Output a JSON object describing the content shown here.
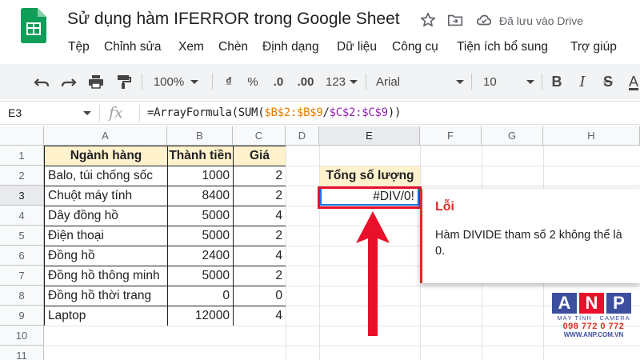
{
  "window": {
    "title": "Sử dụng hàm IFERROR trong Google Sheet",
    "saved_status": "Đã lưu vào Drive"
  },
  "menu": [
    "Tệp",
    "Chỉnh sửa",
    "Xem",
    "Chèn",
    "Định dạng",
    "Dữ liệu",
    "Công cụ",
    "Tiện ích bổ sung",
    "Trợ giúp"
  ],
  "toolbar": {
    "zoom": "100%",
    "currency": "₫",
    "percent": "%",
    "decrease_decimals": ".0",
    "increase_decimals": ".00",
    "more_formats": "123",
    "font": "Arial",
    "font_size": "10",
    "bold": "B",
    "italic": "I",
    "strikethrough": "S",
    "text_color": "A"
  },
  "formula_bar": {
    "cell_ref": "E3",
    "fx": "fx",
    "formula_prefix": "=ArrayFormula(SUM(",
    "range1": "$B$2:$B$9",
    "slash": "/",
    "range2": "$C$2:$C$9",
    "formula_suffix": "))"
  },
  "sheet": {
    "columns": [
      "A",
      "B",
      "C",
      "D",
      "E",
      "F",
      "G",
      "H"
    ],
    "rows": [
      "1",
      "2",
      "3",
      "4",
      "5",
      "6",
      "7",
      "8",
      "9",
      "10",
      "11"
    ],
    "headers": [
      "Ngành hàng",
      "Thành tiền",
      "Giá"
    ],
    "data": [
      [
        "Balo, túi chống sốc",
        "1000",
        "2"
      ],
      [
        "Chuột máy tính",
        "8400",
        "2"
      ],
      [
        "Dây đồng hồ",
        "5000",
        "4"
      ],
      [
        "Điện thoại",
        "5000",
        "2"
      ],
      [
        "Đồng hồ",
        "2400",
        "4"
      ],
      [
        "Đồng hồ thông minh",
        "5000",
        "2"
      ],
      [
        "Đồng hồ thời trang",
        "0",
        "0"
      ],
      [
        "Laptop",
        "12000",
        "4"
      ]
    ],
    "e2": "Tổng số lượng",
    "e3": "#DIV/0!"
  },
  "error_tooltip": {
    "title": "Lỗi",
    "message": "Hàm DIVIDE tham số 2 không thể là 0."
  },
  "watermark": {
    "letters": [
      "A",
      "N",
      "P"
    ],
    "subtitle": "MÁY TÍNH · CAMERA",
    "phone": "098 772 0 772",
    "website": "WWW.ANP.COM.VN"
  },
  "colors": {
    "sheets_green": "#0f9d58",
    "error_red": "#d93025",
    "highlight_red": "#e8102a",
    "header_yellow": "#fff2cc",
    "anp_blue": "#3c4f9f",
    "anp_red": "#e8102a"
  }
}
